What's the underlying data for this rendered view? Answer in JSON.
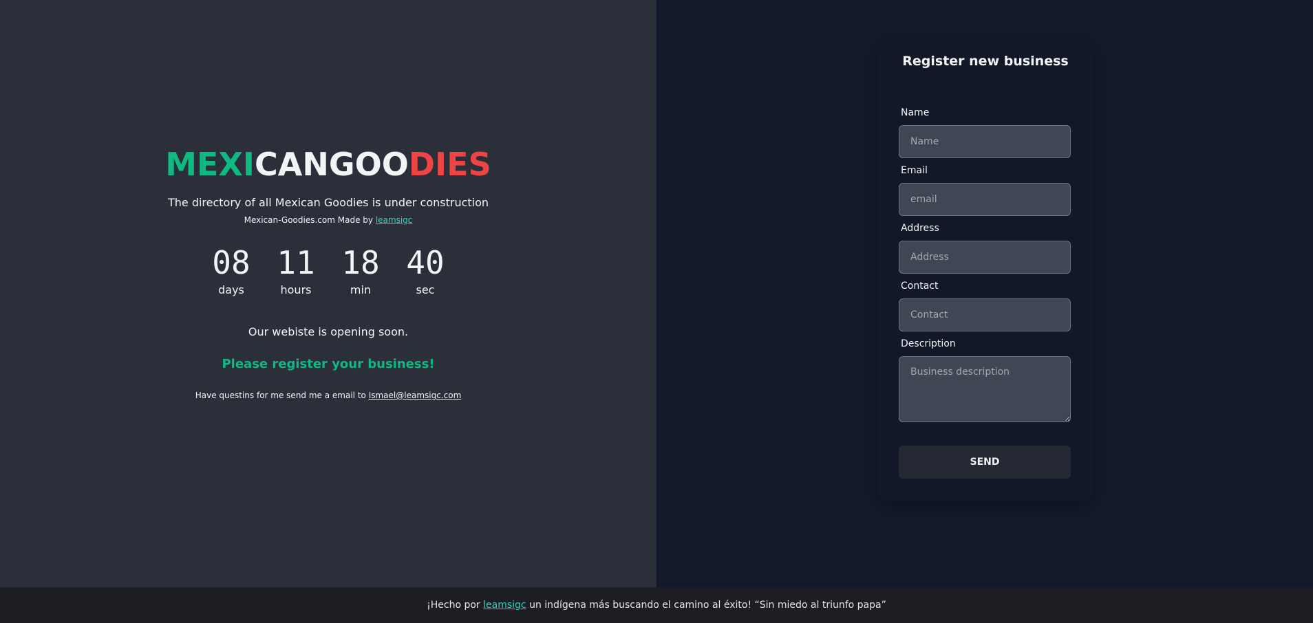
{
  "logo": {
    "part_green": "MEXI",
    "part_white": "CANGOO",
    "part_red": "DIES"
  },
  "tagline": "The directory of all Mexican Goodies is under construction",
  "madeby": {
    "prefix": "Mexican-Goodies.com Made by",
    "link": "leamsigc"
  },
  "countdown": [
    {
      "value": "08",
      "label": "days"
    },
    {
      "value": "11",
      "label": "hours"
    },
    {
      "value": "18",
      "label": "min"
    },
    {
      "value": "40",
      "label": "sec"
    }
  ],
  "opening_soon": "Our webiste is opening soon.",
  "register_cta": "Please register your business!",
  "contact": {
    "prefix": "Have questins for me send me a email to",
    "email": "Ismael@leamsigc.com"
  },
  "form": {
    "title": "Register new business",
    "fields": [
      {
        "label": "Name",
        "placeholder": "Name"
      },
      {
        "label": "Email",
        "placeholder": "email"
      },
      {
        "label": "Address",
        "placeholder": "Address"
      },
      {
        "label": "Contact",
        "placeholder": "Contact"
      },
      {
        "label": "Description",
        "placeholder": "Business description"
      }
    ],
    "send_label": "SEND"
  },
  "footer": {
    "prefix": "¡Hecho por",
    "link": "leamsigc",
    "suffix": "un indígena más buscando el camino al éxito! “Sin miedo al triunfo papa”"
  },
  "colors": {
    "green": "#10b981",
    "red": "#ef4444",
    "teal_link": "#2dd4bf",
    "left_bg": "#2b2f3a",
    "right_bg": "#121a2c"
  }
}
